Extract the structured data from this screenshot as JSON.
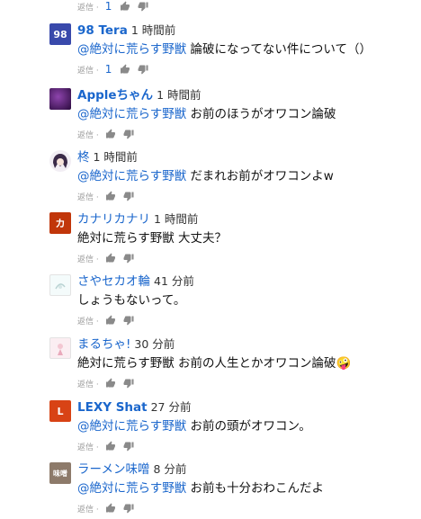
{
  "comments": [
    {
      "author": "",
      "time": "",
      "mention": "",
      "text": "",
      "reply_label": "返信 ·",
      "like_count": "1"
    },
    {
      "author": "98 Tera",
      "time": "1 時間前",
      "mention": "@絶対に荒らす野獣",
      "text": " 論破になってない件について（）",
      "reply_label": "返信 ·",
      "like_count": "1",
      "avatar_text": "98",
      "avatar_color": "#3949ab"
    },
    {
      "author": "Appleちゃん",
      "time": "1 時間前",
      "mention": "@絶対に荒らす野獣",
      "text": " お前のほうがオワコン論破",
      "reply_label": "返信 ·",
      "like_count": "",
      "avatar_color": "#4a1a6b"
    },
    {
      "author": "柊",
      "time": "1 時間前",
      "mention": "@絶対に荒らす野獣",
      "text": " だまれお前がオワコンよw",
      "reply_label": "返信 ·",
      "like_count": ""
    },
    {
      "author": "カナリカナリ",
      "time": "1 時間前",
      "mention": "",
      "text": "絶対に荒らす野獣 大丈夫？",
      "reply_label": "返信 ·",
      "like_count": "",
      "avatar_text": "カ",
      "avatar_color": "#c1360a"
    },
    {
      "author": "さやセカオ輪",
      "time": "41 分前",
      "mention": "",
      "text": "しょうもないって。",
      "reply_label": "返信 ·",
      "like_count": ""
    },
    {
      "author": "まるちゃ!",
      "time": "30 分前",
      "mention": "",
      "text": "絶対に荒らす野獣 お前の人生とかオワコン論破🤪",
      "reply_label": "返信 ·",
      "like_count": ""
    },
    {
      "author": "LEXY Shat",
      "time": "27 分前",
      "mention": "@絶対に荒らす野獣",
      "text": " お前の頭がオワコン。",
      "reply_label": "返信 ·",
      "like_count": "",
      "avatar_text": "L",
      "avatar_color": "#d84315"
    },
    {
      "author": "ラーメン味噌",
      "time": "8 分前",
      "mention": "@絶対に荒らす野獣",
      "text": " お前も十分おわこんだよ",
      "reply_label": "返信 ·",
      "like_count": "",
      "avatar_text": "味噌",
      "avatar_color": "#8d7a6a"
    }
  ],
  "colors": {
    "author": "#1a66cc",
    "mention": "#1a66cc",
    "icon": "#8a8a8a"
  },
  "icons": {
    "like": "thumbs-up-icon",
    "dislike": "thumbs-down-icon"
  }
}
